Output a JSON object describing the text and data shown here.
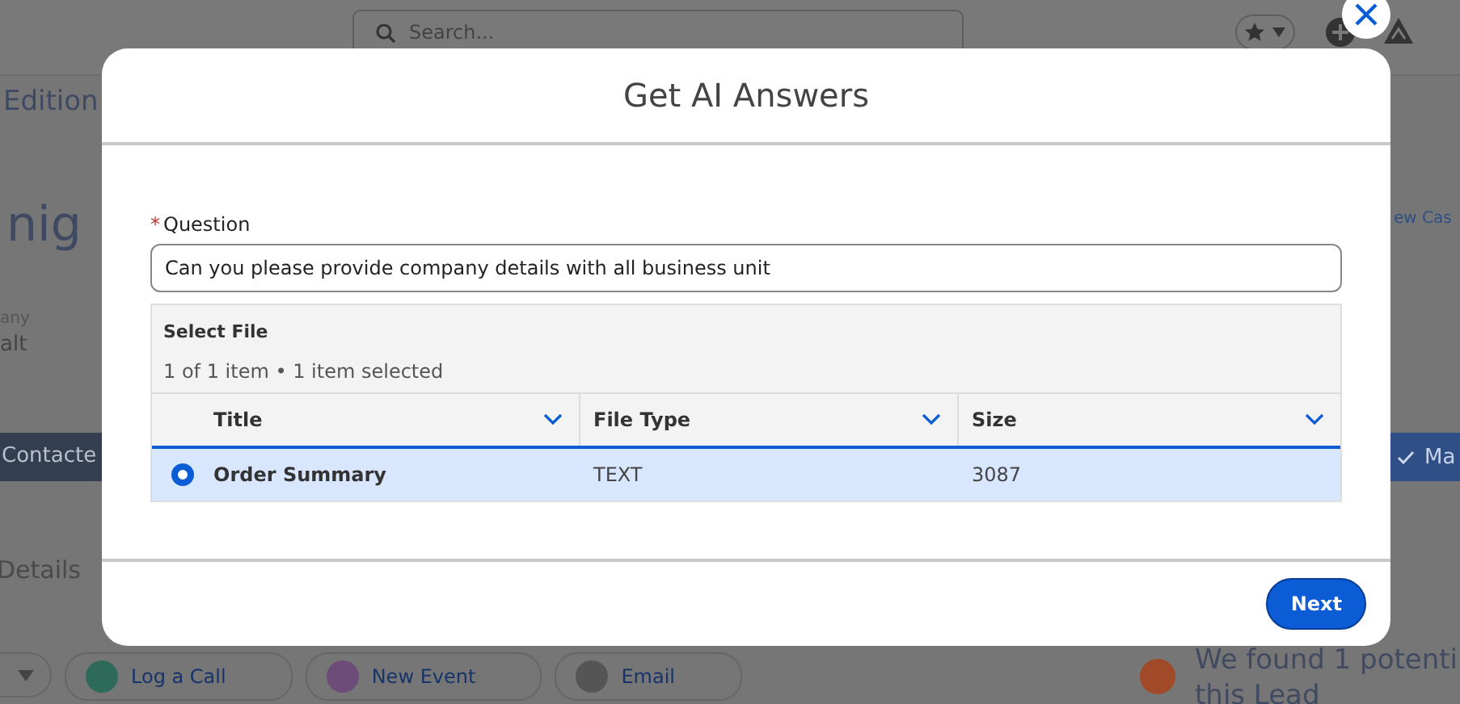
{
  "background": {
    "search": {
      "placeholder": "Search..."
    },
    "record_title_fragment": "Edition",
    "record_name_fragment": "nig",
    "field_label_fragment": "any",
    "field_value_fragment": "alt",
    "status_step_fragment": "Contacte",
    "mark_step_fragment": "Ma",
    "new_case_fragment": "ew Cas",
    "details_heading_fragment": "Details",
    "actions": [
      "Log a Call",
      "New Event",
      "Email"
    ],
    "notice_lines": [
      "We found 1 potenti",
      "this Lead"
    ]
  },
  "modal": {
    "title": "Get AI Answers",
    "question": {
      "label": "Question",
      "required_mark": "*",
      "value": "Can you please provide company details with all business unit"
    },
    "file_picker": {
      "title": "Select File",
      "count": "1 of 1 item • 1 item selected",
      "columns": [
        "Title",
        "File Type",
        "Size"
      ],
      "rows": [
        {
          "selected": true,
          "cells": [
            "Order Summary",
            "TEXT",
            "3087"
          ]
        }
      ]
    },
    "next_button": "Next"
  }
}
